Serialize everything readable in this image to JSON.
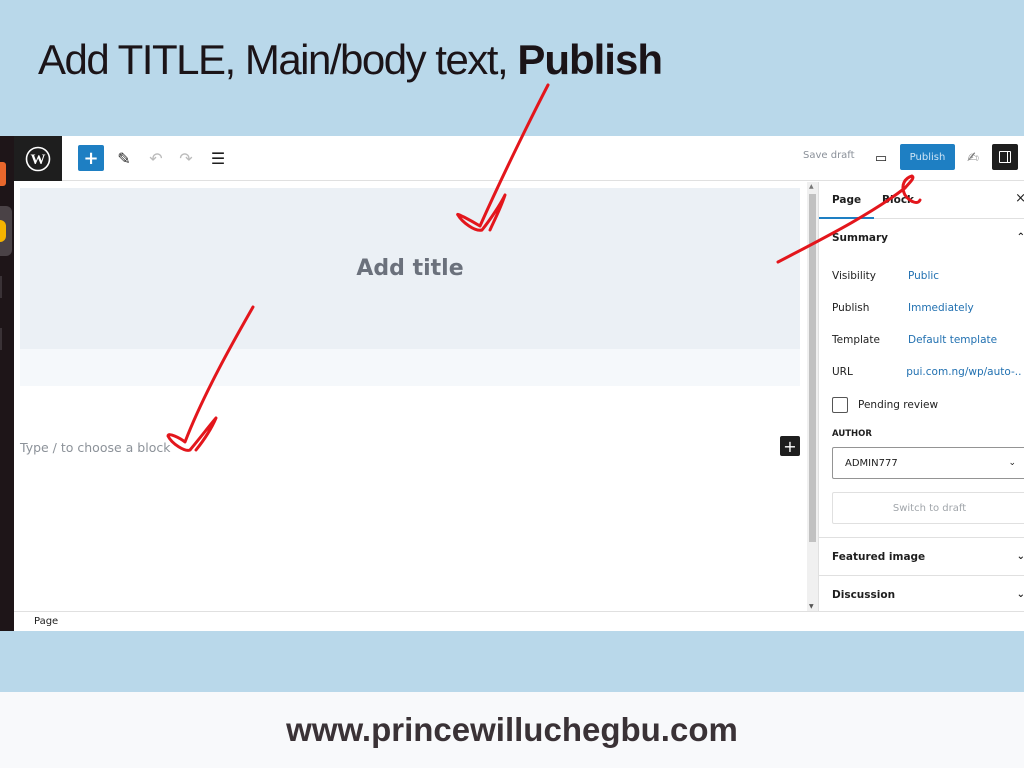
{
  "headline": {
    "regular": "Add TITLE, Main/body text, ",
    "bold": "Publish"
  },
  "toolbar": {
    "logo_icon": "wordpress-logo-icon",
    "inserter_label": "+",
    "save_draft": "Save draft",
    "publish": "Publish"
  },
  "editor": {
    "title_placeholder": "Add title",
    "block_placeholder": "Type / to choose a block",
    "add_block": "+"
  },
  "sidebar": {
    "tabs": [
      {
        "label": "Page",
        "active": true
      },
      {
        "label": "Block",
        "active": false
      }
    ],
    "close": "×",
    "summary": "Summary",
    "rows": [
      {
        "label": "Visibility",
        "value": "Public"
      },
      {
        "label": "Publish",
        "value": "Immediately"
      },
      {
        "label": "Template",
        "value": "Default template"
      },
      {
        "label": "URL",
        "value": "pui.com.ng/wp/auto-..."
      }
    ],
    "pending_review": "Pending review",
    "author_label": "AUTHOR",
    "author_value": "ADMIN777",
    "switch_to_draft": "Switch to draft",
    "panels": [
      "Featured image",
      "Discussion"
    ]
  },
  "footer": {
    "breadcrumb": "Page"
  },
  "website": "www.princewilluchegbu.com",
  "colors": {
    "accent": "#1e7fc3",
    "annotation": "#e3161c",
    "background": "#b9d8ea"
  }
}
